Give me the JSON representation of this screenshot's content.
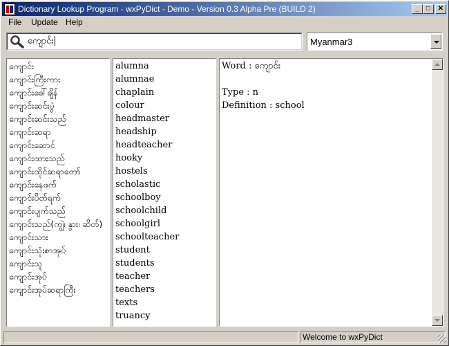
{
  "window": {
    "title": "Dictionary Lookup Program - wxPyDict - Demo - Version 0.3 Alpha Pre (BUILD 2)",
    "minimize_label": "_",
    "maximize_label": "□",
    "close_label": "✕"
  },
  "menu": {
    "items": [
      {
        "label": "File"
      },
      {
        "label": "Update"
      },
      {
        "label": "Help"
      }
    ]
  },
  "search": {
    "value": "ကျောင်း",
    "icon": "search-icon"
  },
  "font_select": {
    "value": "Myanmar3"
  },
  "burmese_list": [
    "ကျောင်း",
    "ကျောင်းကြီးကား",
    "ကျောင်းခေါ်ချိန်",
    "ကျောင်းဆင်းပွဲ",
    "ကျောင်းဆင်းသည်",
    "ကျောင်းဆရာ",
    "ကျောင်းဆောင်",
    "ကျောင်းထားသည်",
    "ကျောင်းထိုင်ဆရာတော်",
    "ကျောင်းနေဖက်",
    "ကျောင်းပိတ်ရက်",
    "ကျောင်းပျက်သည်",
    "ကျောင်းသည်(ကျွဲ၊ နွား၊ ဆိတ်)",
    "ကျောင်းသား",
    "ကျောင်းသုံးစာအုပ်",
    "ကျောင်းသူ",
    "ကျောင်းအုပ်",
    "ကျောင်းအုပ်ဆရာကြီး"
  ],
  "english_list": [
    "alumna",
    "alumnae",
    "chaplain",
    "colour",
    "headmaster",
    "headship",
    "headteacher",
    "hooky",
    "hostels",
    "scholastic",
    "schoolboy",
    "schoolchild",
    "schoolgirl",
    "schoolteacher",
    "student",
    "students",
    "teacher",
    "teachers",
    "texts",
    "truancy"
  ],
  "definition": {
    "word_line": "Word : ကျောင်း",
    "type_line": "Type : n",
    "definition_line": "Definition : school"
  },
  "status": {
    "left": "",
    "right": "Welcome to wxPyDict"
  }
}
